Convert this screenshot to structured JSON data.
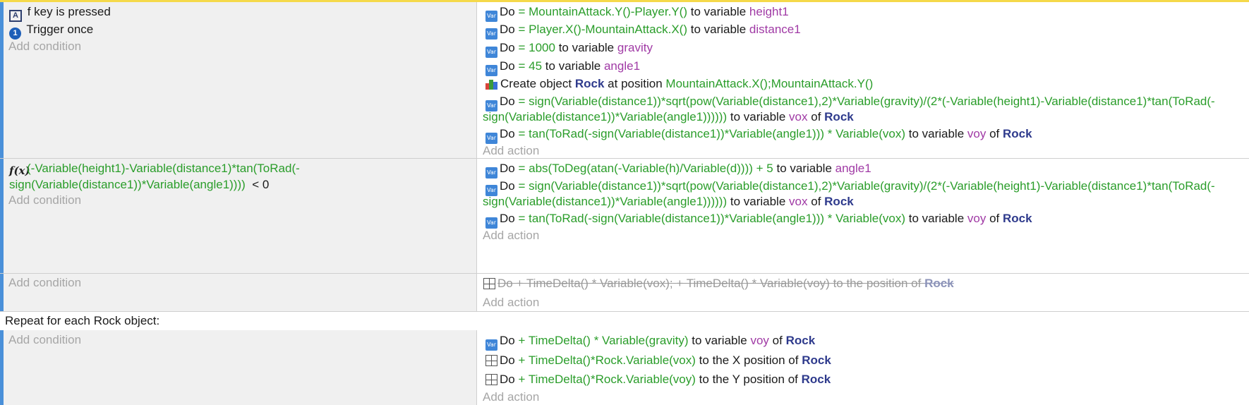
{
  "events": [
    {
      "conditions": [
        {
          "icon": "key-icon",
          "text": "f key is pressed"
        },
        {
          "icon": "trigger-once-icon",
          "text": "Trigger once"
        }
      ],
      "add_condition": "Add condition",
      "add_action": "Add action"
    }
  ],
  "e1": {
    "a1": {
      "do": "Do",
      "eq": "=",
      "expr": "MountainAttack.Y()-Player.Y()",
      "mid": "to variable",
      "var": "height1"
    },
    "a2": {
      "do": "Do",
      "eq": "=",
      "expr": "Player.X()-MountainAttack.X()",
      "mid": "to variable",
      "var": "distance1"
    },
    "a3": {
      "do": "Do",
      "eq": "=",
      "expr": "1000",
      "mid": "to variable",
      "var": "gravity"
    },
    "a4": {
      "do": "Do",
      "eq": "=",
      "expr": "45",
      "mid": "to variable",
      "var": "angle1"
    },
    "a5": {
      "pre": "Create object",
      "obj": "Rock",
      "mid": "at position",
      "expr": "MountainAttack.X();MountainAttack.Y()"
    },
    "a6": {
      "do": "Do",
      "eq": "=",
      "expr1": "sign(Variable(distance1))*sqrt(pow(Variable(distance1),2)*Variable(gravity)/(2*(-Variable(height1)-Variable(distance1)*tan(ToRad(-",
      "expr2": "sign(Variable(distance1))*Variable(angle1))))))",
      "mid": "to variable",
      "var": "vox",
      "of": "of",
      "obj": "Rock"
    },
    "a7": {
      "do": "Do",
      "eq": "=",
      "expr": "tan(ToRad(-sign(Variable(distance1))*Variable(angle1))) * Variable(vox)",
      "mid": "to variable",
      "var": "voy",
      "of": "of",
      "obj": "Rock"
    }
  },
  "e2": {
    "cond_line1": "(-Variable(height1)-Variable(distance1)*tan(ToRad(-",
    "cond_line2": "sign(Variable(distance1))*Variable(angle1))))",
    "cond_op": "< 0",
    "add_condition": "Add condition",
    "add_action": "Add action",
    "a1": {
      "do": "Do",
      "eq": "=",
      "expr": "abs(ToDeg(atan(-Variable(h)/Variable(d)))) + 5",
      "mid": "to variable",
      "var": "angle1"
    },
    "a2": {
      "do": "Do",
      "eq": "=",
      "expr1": "sign(Variable(distance1))*sqrt(pow(Variable(distance1),2)*Variable(gravity)/(2*(-Variable(height1)-Variable(distance1)*tan(ToRad(-",
      "expr2": "sign(Variable(distance1))*Variable(angle1))))))",
      "mid": "to variable",
      "var": "vox",
      "of": "of",
      "obj": "Rock"
    },
    "a3": {
      "do": "Do",
      "eq": "=",
      "expr": "tan(ToRad(-sign(Variable(distance1))*Variable(angle1))) * Variable(vox)",
      "mid": "to variable",
      "var": "voy",
      "of": "of",
      "obj": "Rock"
    }
  },
  "e3": {
    "add_condition": "Add condition",
    "add_action": "Add action",
    "a1": {
      "do": "Do",
      "expr1": "+ TimeDelta() * Variable(vox);",
      "expr2": "+ TimeDelta() * Variable(voy)",
      "mid": "to the position of",
      "obj": "Rock"
    }
  },
  "repeat_label": "Repeat for each Rock object:",
  "e4": {
    "add_condition": "Add condition",
    "add_action": "Add action",
    "a1": {
      "do": "Do",
      "expr": "+ TimeDelta() * Variable(gravity)",
      "mid": "to variable",
      "var": "voy",
      "of": "of",
      "obj": "Rock"
    },
    "a2": {
      "do": "Do",
      "expr": "+ TimeDelta()*Rock.Variable(vox)",
      "mid": "to the X position of",
      "obj": "Rock"
    },
    "a3": {
      "do": "Do",
      "expr": "+ TimeDelta()*Rock.Variable(voy)",
      "mid": "to the Y position of",
      "obj": "Rock"
    }
  },
  "icons": {
    "variable": "Var"
  },
  "colors": {
    "accent": "#4a90d9",
    "expression": "#2a9d2a",
    "variable": "#a03aa5",
    "object": "#2e3a8c",
    "top_highlight": "#f5d94a"
  }
}
